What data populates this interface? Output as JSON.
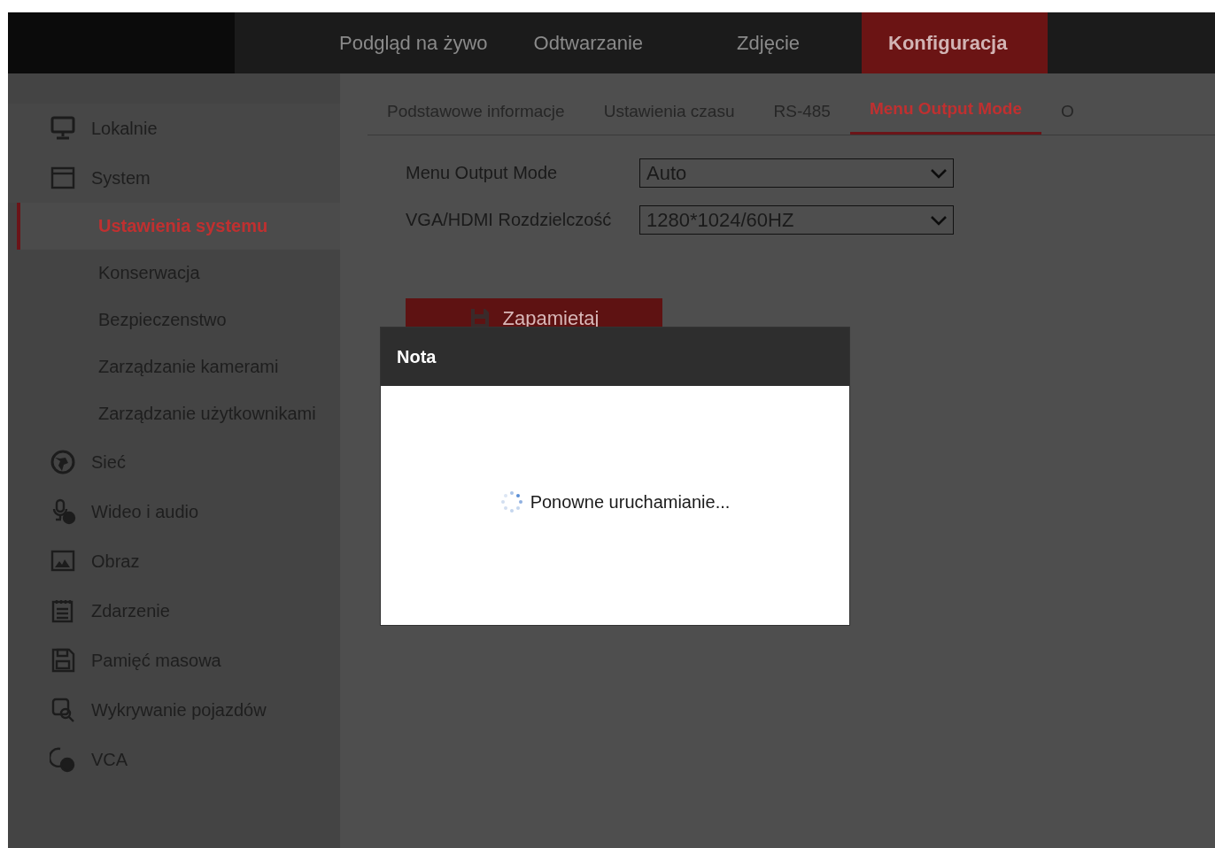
{
  "top_nav": [
    {
      "label": "Podgląd na żywo",
      "selected": false
    },
    {
      "label": "Odtwarzanie",
      "selected": false
    },
    {
      "label": "Zdjęcie",
      "selected": false
    },
    {
      "label": "Konfiguracja",
      "selected": true
    }
  ],
  "sidebar": {
    "items": [
      {
        "label": "Lokalnie",
        "selected": false
      },
      {
        "label": "System",
        "selected": false,
        "expanded": true,
        "children": [
          {
            "label": "Ustawienia systemu",
            "selected": true
          },
          {
            "label": "Konserwacja",
            "selected": false
          },
          {
            "label": "Bezpieczenstwo",
            "selected": false
          },
          {
            "label": "Zarządzanie kamerami",
            "selected": false
          },
          {
            "label": "Zarządzanie użytkownikami",
            "selected": false
          }
        ]
      },
      {
        "label": "Sieć",
        "selected": false
      },
      {
        "label": "Wideo i audio",
        "selected": false
      },
      {
        "label": "Obraz",
        "selected": false
      },
      {
        "label": "Zdarzenie",
        "selected": false
      },
      {
        "label": "Pamięć masowa",
        "selected": false
      },
      {
        "label": "Wykrywanie pojazdów",
        "selected": false
      },
      {
        "label": "VCA",
        "selected": false
      }
    ]
  },
  "tabs": [
    {
      "label": "Podstawowe informacje",
      "selected": false
    },
    {
      "label": "Ustawienia czasu",
      "selected": false
    },
    {
      "label": "RS-485",
      "selected": false
    },
    {
      "label": "Menu Output Mode",
      "selected": true
    },
    {
      "label": "O",
      "selected": false
    }
  ],
  "form": [
    {
      "label": "Menu Output Mode",
      "value": "Auto"
    },
    {
      "label": "VGA/HDMI Rozdzielczość",
      "value": "1280*1024/60HZ"
    }
  ],
  "save_button": {
    "label": "Zapamietaj"
  },
  "dialog": {
    "title": "Nota",
    "message": "Ponowne uruchamianie...",
    "loading": true
  }
}
